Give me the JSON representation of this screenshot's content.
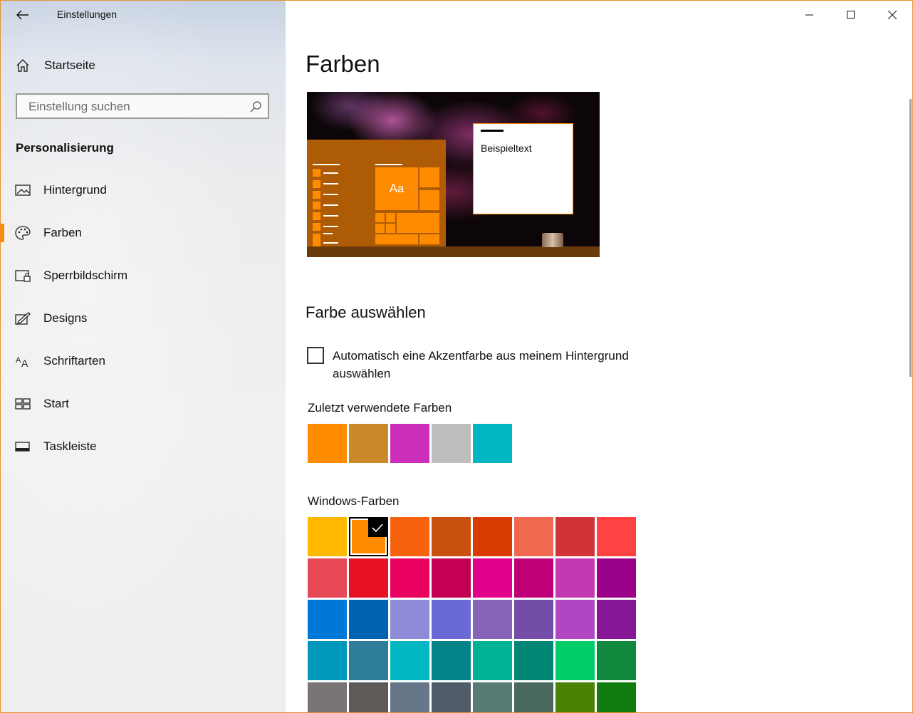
{
  "window": {
    "title": "Einstellungen",
    "accent_color": "#FF8C00"
  },
  "sidebar": {
    "home_label": "Startseite",
    "search_placeholder": "Einstellung suchen",
    "section_title": "Personalisierung",
    "items": [
      {
        "label": "Hintergrund",
        "icon": "image-icon",
        "active": false
      },
      {
        "label": "Farben",
        "icon": "palette-icon",
        "active": true
      },
      {
        "label": "Sperrbildschirm",
        "icon": "lock-screen-icon",
        "active": false
      },
      {
        "label": "Designs",
        "icon": "designs-icon",
        "active": false
      },
      {
        "label": "Schriftarten",
        "icon": "font-icon",
        "active": false
      },
      {
        "label": "Start",
        "icon": "start-icon",
        "active": false
      },
      {
        "label": "Taskleiste",
        "icon": "taskbar-icon",
        "active": false
      }
    ]
  },
  "main": {
    "page_title": "Farben",
    "preview": {
      "sample_text": "Beispieltext",
      "tile_text": "Aa"
    },
    "choose_heading": "Farbe auswählen",
    "auto_accent": {
      "label": "Automatisch eine Akzentfarbe aus meinem Hintergrund auswählen",
      "checked": false
    },
    "recent_label": "Zuletzt verwendete Farben",
    "recent_colors": [
      "#FF8C00",
      "#CA8A2C",
      "#CB2FB9",
      "#BDBDBD",
      "#00B7C3"
    ],
    "windows_label": "Windows-Farben",
    "selected_color": "#FF8C00",
    "windows_colors": [
      [
        "#FFB900",
        "#FF8C00",
        "#F7630C",
        "#CA5010",
        "#DA3B01",
        "#EF6950",
        "#D13438",
        "#FF4343"
      ],
      [
        "#E74856",
        "#E81123",
        "#EA005E",
        "#C30052",
        "#E3008C",
        "#BF0077",
        "#C239B3",
        "#9A0089"
      ],
      [
        "#0078D7",
        "#0063B1",
        "#8E8CD8",
        "#6B69D6",
        "#8764B8",
        "#744DA9",
        "#B146C2",
        "#881798"
      ],
      [
        "#0099BC",
        "#2D7D9A",
        "#00B7C3",
        "#038387",
        "#00B294",
        "#018574",
        "#00CC6A",
        "#10893E"
      ],
      [
        "#7A7574",
        "#5D5A58",
        "#68768A",
        "#515C6B",
        "#567C73",
        "#486860",
        "#498205",
        "#107C10"
      ]
    ]
  }
}
